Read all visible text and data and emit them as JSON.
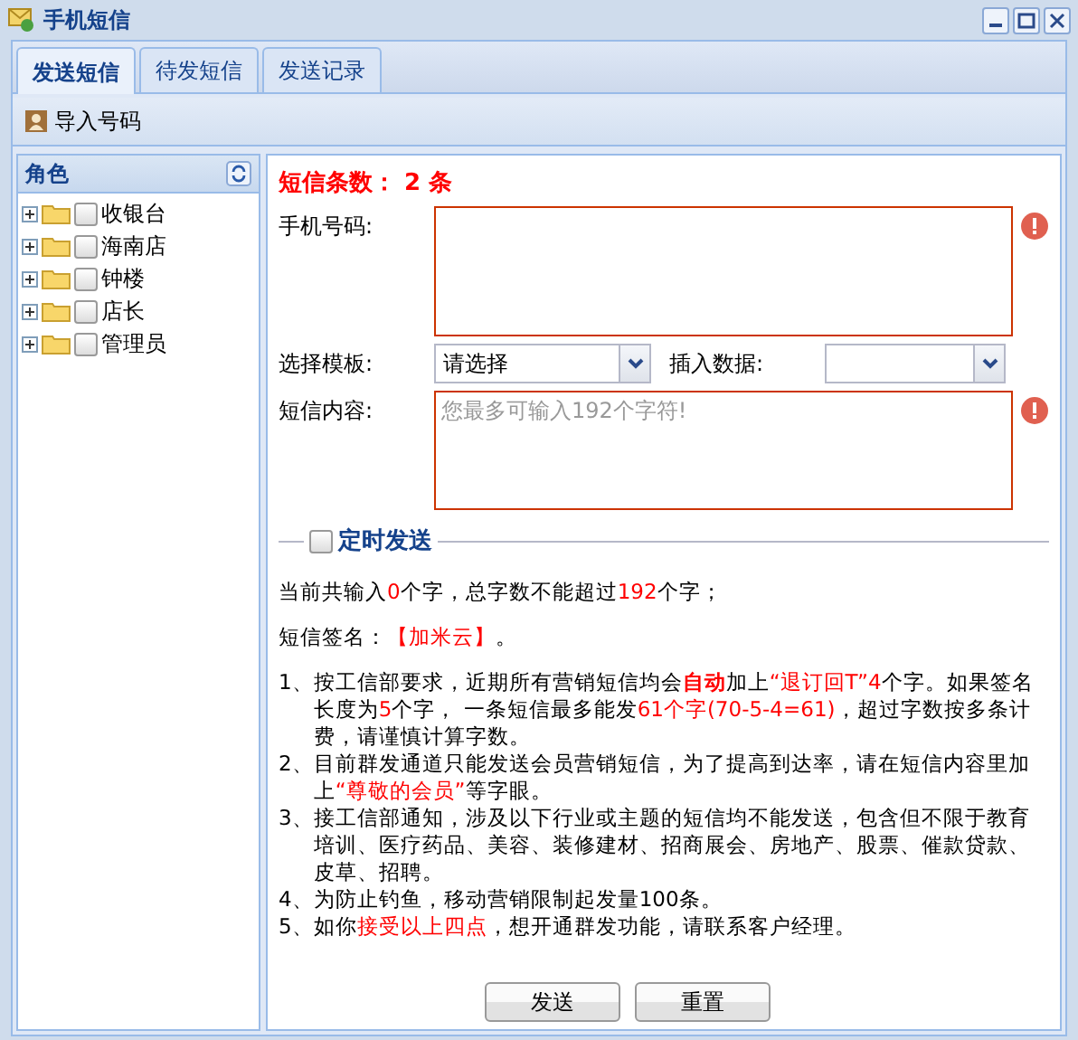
{
  "window": {
    "title": "手机短信"
  },
  "tabs": [
    {
      "label": "发送短信",
      "selected": true
    },
    {
      "label": "待发短信",
      "selected": false
    },
    {
      "label": "发送记录",
      "selected": false
    }
  ],
  "toolbar": {
    "import_button": "导入号码"
  },
  "role_panel": {
    "title": "角色",
    "items": [
      {
        "label": "收银台",
        "checked": false,
        "expanded": false
      },
      {
        "label": "海南店",
        "checked": false,
        "expanded": false
      },
      {
        "label": "钟楼",
        "checked": false,
        "expanded": false
      },
      {
        "label": "店长",
        "checked": false,
        "expanded": false
      },
      {
        "label": "管理员",
        "checked": false,
        "expanded": false
      }
    ]
  },
  "form": {
    "count": "短信条数： 2 条",
    "phone": {
      "label": "手机号码:",
      "invalid": true
    },
    "template": {
      "label": "选择模板:",
      "value": "请选择"
    },
    "insert_data": {
      "label": "插入数据:"
    },
    "content": {
      "label": "短信内容:",
      "placeholder": "您最多可输入192个字符!",
      "invalid": true
    },
    "schedule": {
      "label": "定时发送",
      "checked": false
    }
  },
  "counter": [
    {
      "text": "当前共输入",
      "kind": "plain"
    },
    {
      "text": "0",
      "kind": "red"
    },
    {
      "text": "个字，总字数不能超过",
      "kind": "plain"
    },
    {
      "text": "192",
      "kind": "red"
    },
    {
      "text": "个字；",
      "kind": "plain"
    }
  ],
  "signature": [
    {
      "text": "短信签名：",
      "kind": "plain"
    },
    {
      "text": "【加米云】",
      "kind": "red"
    },
    {
      "text": "。",
      "kind": "plain"
    }
  ],
  "notes": [
    {
      "number": "1、",
      "segments": [
        {
          "text": "按工信部要求，近期所有营销短信均会",
          "kind": "plain"
        },
        {
          "text": "自动",
          "kind": "strong"
        },
        {
          "text": "加上",
          "kind": "plain"
        },
        {
          "text": "“退订回T”4",
          "kind": "red"
        },
        {
          "text": "个字。如果签名长度为",
          "kind": "plain"
        },
        {
          "text": "5",
          "kind": "red"
        },
        {
          "text": "个字， 一条短信最多能发",
          "kind": "plain"
        },
        {
          "text": "61个字(70-5-4=61)",
          "kind": "red"
        },
        {
          "text": "，超过字数按多条计费，请谨慎计算字数。",
          "kind": "plain"
        }
      ]
    },
    {
      "number": "2、",
      "segments": [
        {
          "text": "目前群发通道只能发送会员营销短信，为了提高到达率，请在短信内容里加上",
          "kind": "plain"
        },
        {
          "text": "“尊敬的会员”",
          "kind": "red"
        },
        {
          "text": "等字眼。",
          "kind": "plain"
        }
      ]
    },
    {
      "number": "3、",
      "segments": [
        {
          "text": "接工信部通知，涉及以下行业或主题的短信均不能发送，包含但不限于教育培训、医疗药品、美容、装修建材、招商展会、房地产、股票、催款贷款、皮草、招聘。",
          "kind": "plain"
        }
      ]
    },
    {
      "number": "4、",
      "segments": [
        {
          "text": "为防止钓鱼，移动营销限制起发量100条。",
          "kind": "plain"
        }
      ]
    },
    {
      "number": "5、",
      "segments": [
        {
          "text": "如你",
          "kind": "plain"
        },
        {
          "text": "接受以上四点",
          "kind": "red"
        },
        {
          "text": "，想开通群发功能，请联系客户经理。",
          "kind": "plain"
        }
      ]
    }
  ],
  "buttons": [
    "发送",
    "重置"
  ]
}
